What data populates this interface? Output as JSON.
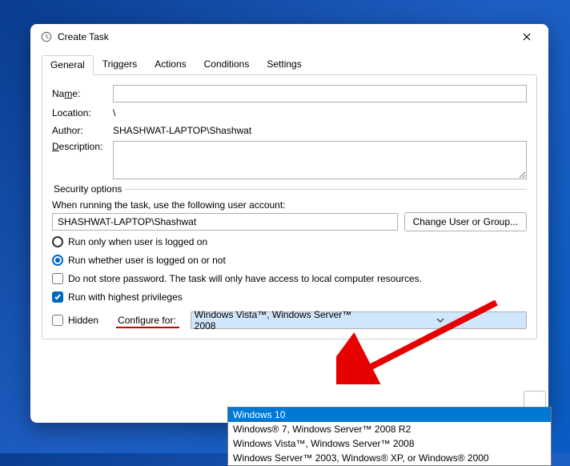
{
  "title": "Create Task",
  "tabs": [
    "General",
    "Triggers",
    "Actions",
    "Conditions",
    "Settings"
  ],
  "labels": {
    "name": "Name:",
    "location": "Location:",
    "author": "Author:",
    "description": "Description:",
    "security_options": "Security options",
    "when_running": "When running the task, use the following user account:",
    "change_user": "Change User or Group...",
    "run_logged_on": "Run only when user is logged on",
    "run_whether": "Run whether user is logged on or not",
    "no_store_pw": "Do not store password.  The task will only have access to local computer resources.",
    "highest_priv": "Run with highest privileges",
    "hidden": "Hidden",
    "configure_for": "Configure for:"
  },
  "values": {
    "name": "",
    "location": "\\",
    "author": "SHASHWAT-LAPTOP\\Shashwat",
    "user_account": "SHASHWAT-LAPTOP\\Shashwat",
    "configure_selected": "Windows Vista™, Windows Server™ 2008"
  },
  "state": {
    "run_logged_on": false,
    "run_whether": true,
    "no_store_pw": false,
    "highest_priv": true,
    "hidden": false
  },
  "dropdown": [
    "Windows 10",
    "Windows® 7, Windows Server™ 2008 R2",
    "Windows Vista™, Windows Server™ 2008",
    "Windows Server™ 2003, Windows® XP, or Windows® 2000"
  ],
  "dropdown_selected_index": 0
}
